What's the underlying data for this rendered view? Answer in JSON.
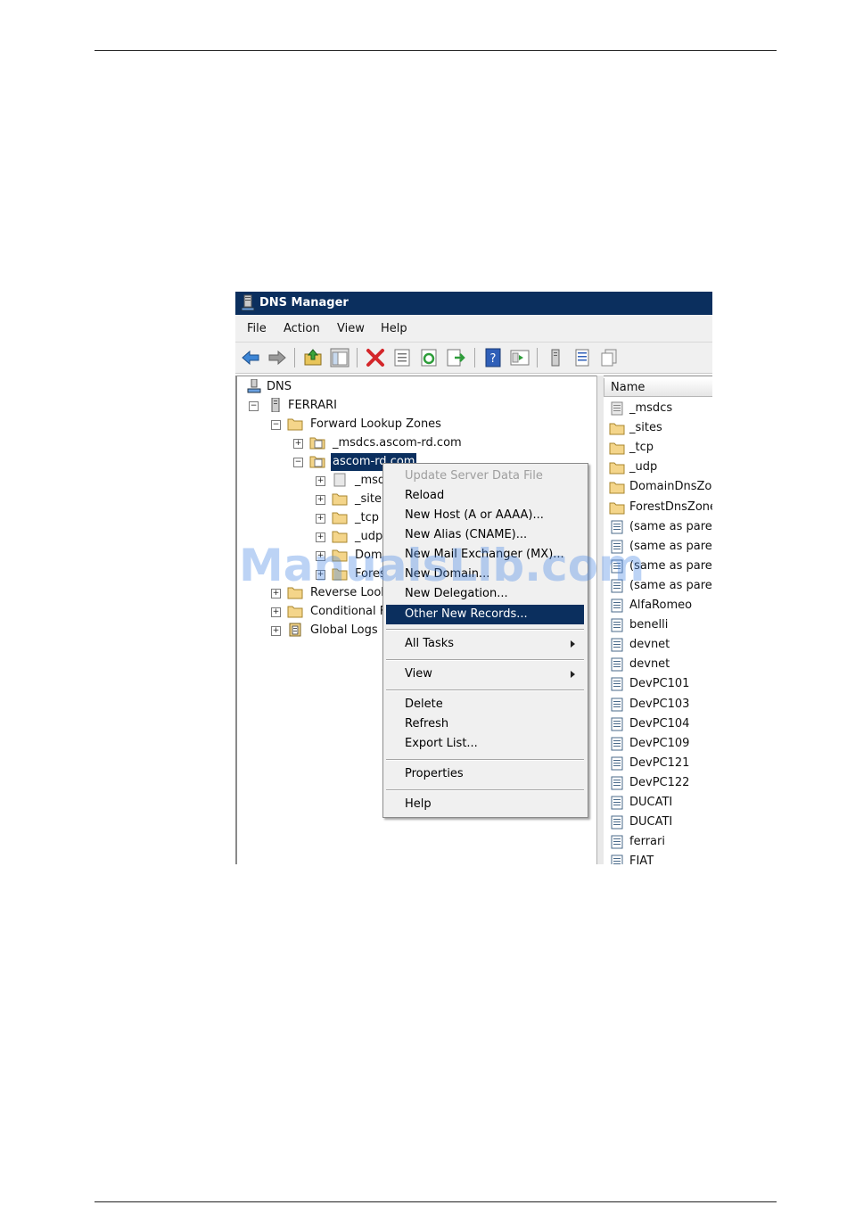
{
  "window": {
    "title": "DNS Manager"
  },
  "menu": [
    "File",
    "Action",
    "View",
    "Help"
  ],
  "toolbar_icons": [
    "back-arrow-icon",
    "forward-arrow-icon",
    "up-folder-icon",
    "show-hide-tree-icon",
    "delete-icon",
    "properties-icon",
    "refresh-icon",
    "export-list-icon",
    "help-icon",
    "console-tree-icon",
    "server-icon",
    "list-view-icon",
    "zone-records-icon"
  ],
  "tree": {
    "root": "DNS",
    "server": "FERRARI",
    "forward_zones": "Forward Lookup Zones",
    "zone_msdcs": "_msdcs.ascom-rd.com",
    "zone_selected": "ascom-rd.com",
    "sub_msdcs": "_msd",
    "sub_sites": "_site",
    "sub_tcp": "_tcp",
    "sub_udp": "_udp",
    "sub_domain": "Doma",
    "sub_forest": "Fores",
    "reverse_zones": "Reverse Look",
    "conditional": "Conditional F",
    "global_logs": "Global Logs"
  },
  "list": {
    "header_name": "Name",
    "items": [
      {
        "label": "_msdcs",
        "icon": "zone"
      },
      {
        "label": "_sites",
        "icon": "folder"
      },
      {
        "label": "_tcp",
        "icon": "folder"
      },
      {
        "label": "_udp",
        "icon": "folder"
      },
      {
        "label": "DomainDnsZon",
        "icon": "folder"
      },
      {
        "label": "ForestDnsZone",
        "icon": "folder"
      },
      {
        "label": "(same as parer",
        "icon": "record"
      },
      {
        "label": "(same as parer",
        "icon": "record"
      },
      {
        "label": "(same as parer",
        "icon": "record"
      },
      {
        "label": "(same as parer",
        "icon": "record"
      },
      {
        "label": "AlfaRomeo",
        "icon": "record"
      },
      {
        "label": "benelli",
        "icon": "record"
      },
      {
        "label": "devnet",
        "icon": "record"
      },
      {
        "label": "devnet",
        "icon": "record"
      },
      {
        "label": "DevPC101",
        "icon": "record"
      },
      {
        "label": "DevPC103",
        "icon": "record"
      },
      {
        "label": "DevPC104",
        "icon": "record"
      },
      {
        "label": "DevPC109",
        "icon": "record"
      },
      {
        "label": "DevPC121",
        "icon": "record"
      },
      {
        "label": "DevPC122",
        "icon": "record"
      },
      {
        "label": "DUCATI",
        "icon": "record"
      },
      {
        "label": "DUCATI",
        "icon": "record"
      },
      {
        "label": "ferrari",
        "icon": "record"
      },
      {
        "label": "FIAT",
        "icon": "record"
      }
    ]
  },
  "context_menu": {
    "update_server_data_file": "Update Server Data File",
    "reload": "Reload",
    "new_host": "New Host (A or AAAA)...",
    "new_alias": "New Alias (CNAME)...",
    "new_mail_exchanger": "New Mail Exchanger (MX)...",
    "new_domain": "New Domain...",
    "new_delegation": "New Delegation...",
    "other_new_records": "Other New Records...",
    "all_tasks": "All Tasks",
    "view": "View",
    "delete": "Delete",
    "refresh": "Refresh",
    "export_list": "Export List...",
    "properties": "Properties",
    "help": "Help"
  },
  "watermark": "ManualsLib.com"
}
